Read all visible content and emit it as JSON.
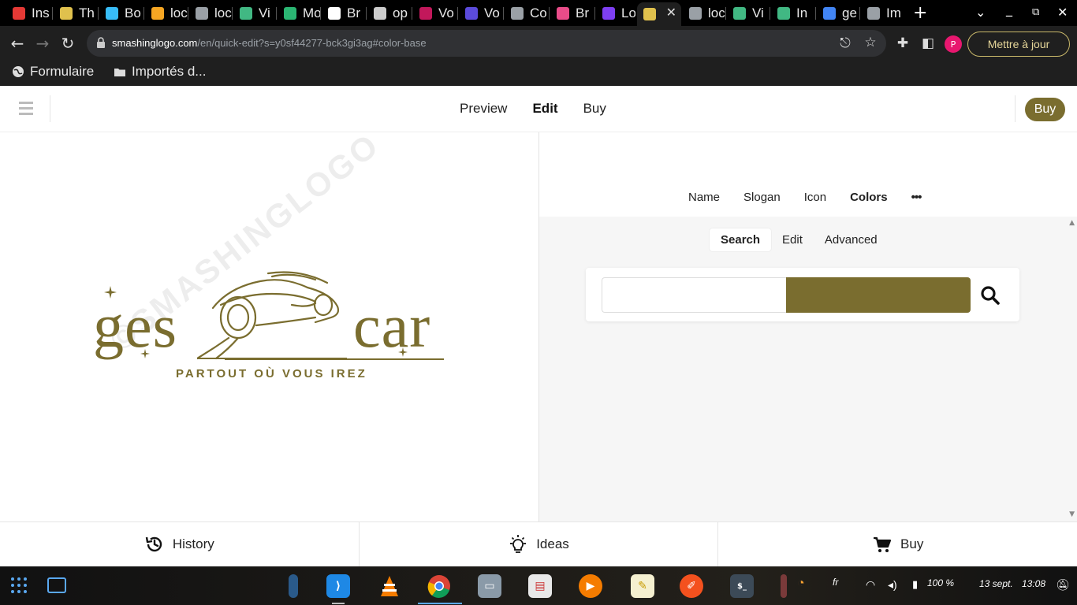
{
  "browser": {
    "tabs": [
      {
        "title": "Ins",
        "fav_color": "#e53935"
      },
      {
        "title": "Th",
        "fav_color": "#e0c14d"
      },
      {
        "title": "Bo",
        "fav_color": "#38bdf8"
      },
      {
        "title": "loc",
        "fav_color": "#f5a623"
      },
      {
        "title": "loc",
        "fav_color": "#9aa0a6"
      },
      {
        "title": "Vi",
        "fav_color": "#41b883"
      },
      {
        "title": "Mo",
        "fav_color": "#2bb673"
      },
      {
        "title": "Br",
        "fav_color": "#ffffff"
      },
      {
        "title": "op",
        "fav_color": "#cccccc"
      },
      {
        "title": "Vo",
        "fav_color": "#c2185b"
      },
      {
        "title": "Vo",
        "fav_color": "#5b4bdb"
      },
      {
        "title": "Co",
        "fav_color": "#9aa0a6"
      },
      {
        "title": "Br",
        "fav_color": "#ea4c89"
      },
      {
        "title": "Lo",
        "fav_color": "#7e3ff2"
      },
      {
        "title": "",
        "fav_color": "#e0c14d",
        "active": true
      },
      {
        "title": "loc",
        "fav_color": "#9aa0a6"
      },
      {
        "title": "Vi",
        "fav_color": "#41b883"
      },
      {
        "title": "In",
        "fav_color": "#41b883"
      },
      {
        "title": "ge",
        "fav_color": "#4285f4"
      },
      {
        "title": "Im",
        "fav_color": "#9aa0a6"
      }
    ],
    "url_host": "smashinglogo.com",
    "url_path": "/en/quick-edit?s=y0sf44277-bck3gi3ag#color-base",
    "profile_initial": "P",
    "update_label": "Mettre à jour",
    "bookmarks": [
      "Formulaire",
      "Importés d..."
    ]
  },
  "header": {
    "nav": [
      "Preview",
      "Edit",
      "Buy"
    ],
    "active_nav": "Edit",
    "buy_button": "Buy"
  },
  "logo": {
    "word_left": "ges",
    "word_right": "car",
    "slogan": "PARTOUT OÙ VOUS IREZ",
    "color": "#7a6d2f",
    "watermark": "©SMASHINGLOGO"
  },
  "editor": {
    "tabs": [
      "Name",
      "Slogan",
      "Icon",
      "Colors"
    ],
    "active_tab": "Colors",
    "more_label": "•••",
    "sub_tabs": [
      "Search",
      "Edit",
      "Advanced"
    ],
    "active_sub_tab": "Search",
    "search_value": "",
    "selected_color": "#7a6d2f"
  },
  "bottom": {
    "history": "History",
    "ideas": "Ideas",
    "buy": "Buy"
  },
  "taskbar": {
    "keyboard_layout": "fr",
    "battery": "100 %",
    "date": "13 sept.",
    "time": "13:08"
  }
}
